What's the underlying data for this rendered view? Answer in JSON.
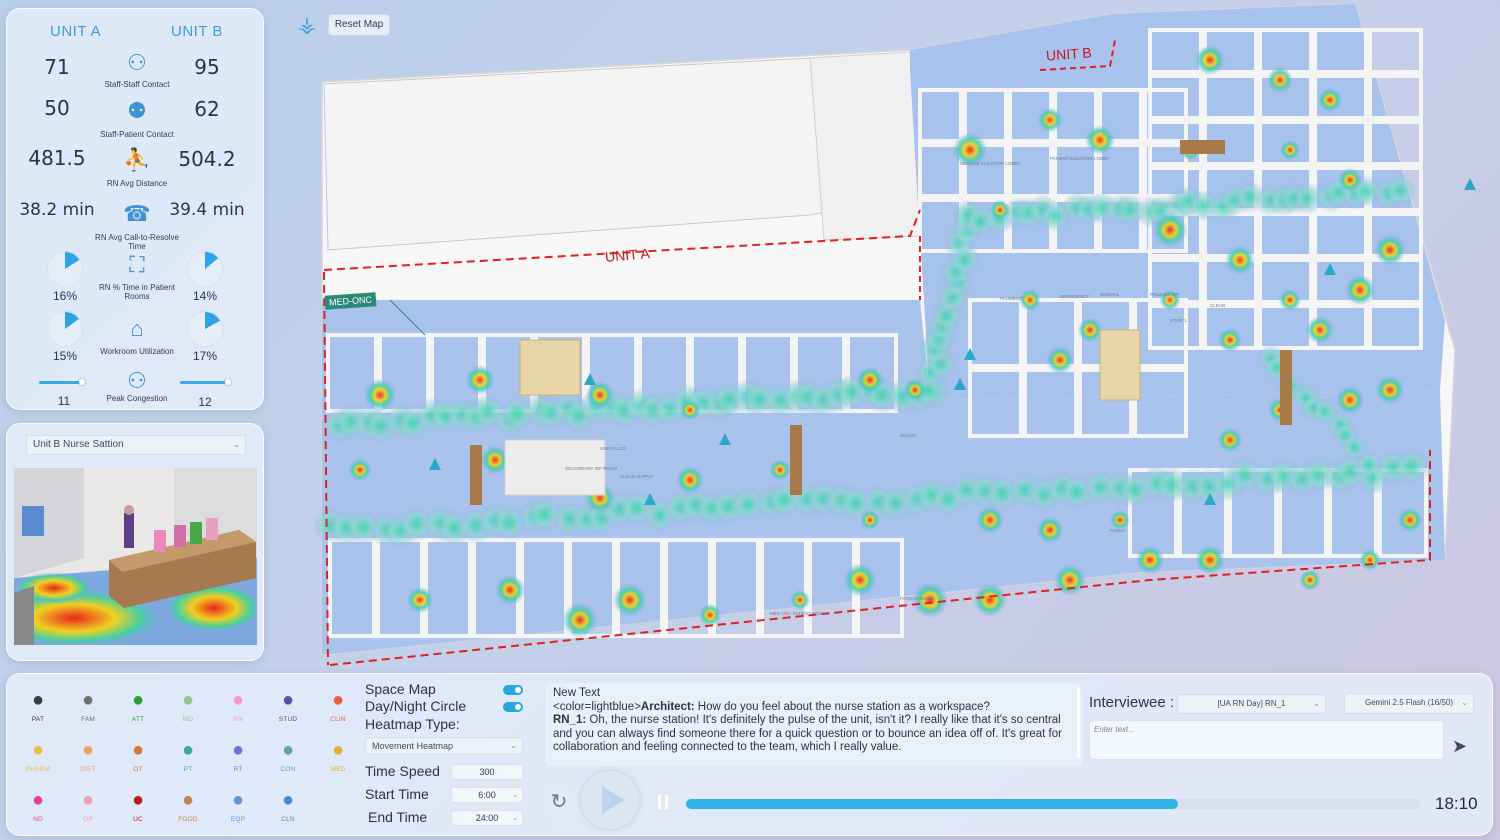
{
  "top": {
    "reset_label": "Reset Map"
  },
  "stats": {
    "unit_a": "UNIT A",
    "unit_b": "UNIT B",
    "rows": [
      {
        "label": "Staff-Staff Contact",
        "a": "71",
        "b": "95",
        "icon": "staff-staff-icon"
      },
      {
        "label": "Staff-Patient Contact",
        "a": "50",
        "b": "62",
        "icon": "staff-patient-icon"
      },
      {
        "label": "RN Avg Distance",
        "a": "481.5",
        "b": "504.2",
        "icon": "walking-distance-icon"
      },
      {
        "label": "RN Avg Call-to-Resolve Time",
        "a": "38.2 min",
        "b": "39.4 min",
        "icon": "call-resolve-icon"
      }
    ],
    "time_in_rooms": {
      "label": "RN % Time in Patient Rooms",
      "a": "16%",
      "b": "14%",
      "a_value": 0.16,
      "b_value": 0.14,
      "icon": "patient-room-icon"
    },
    "workroom": {
      "label": "Workroom Utilization",
      "a": "15%",
      "b": "17%",
      "a_value": 0.15,
      "b_value": 0.17,
      "icon": "workroom-icon"
    },
    "congestion": {
      "label": "Peak Congestion",
      "a": "11",
      "b": "12",
      "a_level": 0.9,
      "b_level": 1.0,
      "icon": "congestion-icon"
    }
  },
  "camera": {
    "selected": "Unit B  Nurse  Sattion"
  },
  "map": {
    "unit_a_label": "UNIT A",
    "unit_b_label": "UNIT B",
    "med_onc_tag": "MED-ONC",
    "room_labels": [
      "SERVICE ELEVATOR LOBBY",
      "PATIENT ELEVATOR LOBBY",
      "PLUMBING",
      "EMERGENCY",
      "NORMAL",
      "PRIMARY IDF",
      "CLEAN",
      "STAIR 1",
      "UNEN ALCO",
      "SECONDARY IDF ROOM",
      "CLEAN SUPPLY",
      "SOILED",
      "MED-ONC PATIENT ROOM",
      "PATIENT ROOM",
      "FAMILY"
    ]
  },
  "agents": [
    {
      "code": "PAT",
      "icon": "patient-bed-icon",
      "color": "#3a3a3a"
    },
    {
      "code": "FAM",
      "icon": "family-icon",
      "color": "#707070"
    },
    {
      "code": "ATT",
      "icon": "attending-icon",
      "color": "#2e9e3a"
    },
    {
      "code": "MD",
      "icon": "doctor-icon",
      "color": "#8cc98a"
    },
    {
      "code": "RN",
      "icon": "nurse-icon",
      "color": "#f09ac8"
    },
    {
      "code": "STUD",
      "icon": "student-icon",
      "color": "#5a4ea8"
    },
    {
      "code": "CLIN",
      "icon": "clinician-running-icon",
      "color": "#e86040"
    },
    {
      "code": "PHARM",
      "icon": "pharmacist-icon",
      "color": "#e8c040"
    },
    {
      "code": "DIET",
      "icon": "dietitian-icon",
      "color": "#f0a060"
    },
    {
      "code": "OT",
      "icon": "occupational-therapist-icon",
      "color": "#d07a40"
    },
    {
      "code": "PT",
      "icon": "physical-therapist-icon",
      "color": "#3aa890"
    },
    {
      "code": "RT",
      "icon": "respiratory-therapist-icon",
      "color": "#6a78c8"
    },
    {
      "code": "CON",
      "icon": "consultant-icon",
      "color": "#5ca8a0"
    },
    {
      "code": "MED",
      "icon": "medic-icon",
      "color": "#e0b030"
    },
    {
      "code": "ND",
      "icon": "nurse-director-icon",
      "color": "#e040a8"
    },
    {
      "code": "OP",
      "icon": "outpatient-icon",
      "color": "#f0a0b0"
    },
    {
      "code": "UC",
      "icon": "unit-clerk-icon",
      "color": "#b02020"
    },
    {
      "code": "FOOD",
      "icon": "food-service-icon",
      "color": "#c08850"
    },
    {
      "code": "EQP",
      "icon": "equipment-icon",
      "color": "#5a98d8"
    },
    {
      "code": "CLN",
      "icon": "cleaner-icon",
      "color": "#4a8ac8"
    }
  ],
  "controls": {
    "space_map": "Space Map",
    "day_night": "Day/Night Circle",
    "heatmap_type_label": "Heatmap Type:",
    "heatmap_type": "Movement Heatmap",
    "time_speed_label": "Time Speed",
    "time_speed": "300",
    "start_time_label": "Start Time",
    "start_time": "6:00",
    "end_time_label": "End Time",
    "end_time": "24:00"
  },
  "chat": {
    "line1": "New Text",
    "prefix": "<color=lightblue>",
    "speaker1": "Architect:",
    "q": " How do you feel about the nurse station as a workspace?",
    "speaker2": "RN_1:",
    "answer": " Oh, the nurse station! It's definitely the pulse of the unit, isn't it? I really like that it's so central and you can always find someone there for a quick question or to bounce an idea off of. It's great for collaboration and feeling connected to the team, which I really value."
  },
  "interview": {
    "label": "Interviewee :",
    "interviewee": "[UA RN Day] RN_1",
    "model": "Gemini 2.5 Flash (16/50)",
    "placeholder": "Enter text..."
  },
  "playback": {
    "progress": 0.67,
    "time": "18:10"
  }
}
